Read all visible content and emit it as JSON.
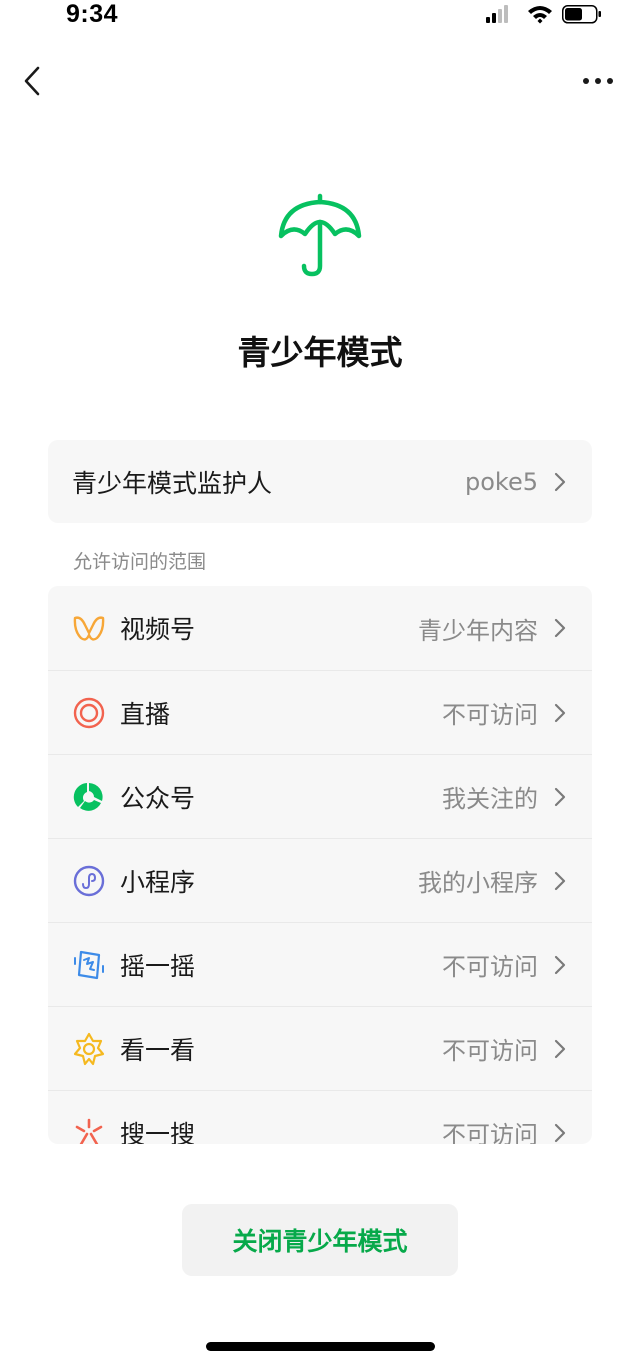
{
  "status_bar": {
    "time": "9:34"
  },
  "page": {
    "title": "青少年模式"
  },
  "guardian": {
    "label": "青少年模式监护人",
    "value": "poke5"
  },
  "scope": {
    "caption": "允许访问的范围",
    "items": [
      {
        "label": "视频号",
        "value": "青少年内容",
        "icon": "channels-icon"
      },
      {
        "label": "直播",
        "value": "不可访问",
        "icon": "live-icon"
      },
      {
        "label": "公众号",
        "value": "我关注的",
        "icon": "official-accounts-icon"
      },
      {
        "label": "小程序",
        "value": "我的小程序",
        "icon": "mini-program-icon"
      },
      {
        "label": "摇一摇",
        "value": "不可访问",
        "icon": "shake-icon"
      },
      {
        "label": "看一看",
        "value": "不可访问",
        "icon": "top-stories-icon"
      },
      {
        "label": "搜一搜",
        "value": "不可访问",
        "icon": "search-icon"
      }
    ]
  },
  "actions": {
    "close_label": "关闭青少年模式"
  },
  "colors": {
    "accent": "#07a94a",
    "card_background": "#f7f7f7",
    "secondary_text": "#8a8a8a"
  }
}
